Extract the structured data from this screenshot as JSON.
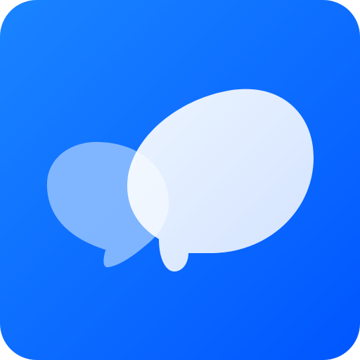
{
  "icon": {
    "name": "chat-bubbles-app-icon",
    "colors": {
      "background_start": "#1a84ff",
      "background_end": "#0056ff",
      "bubble_back": "#8fbfff",
      "bubble_front": "#e4efff"
    }
  }
}
